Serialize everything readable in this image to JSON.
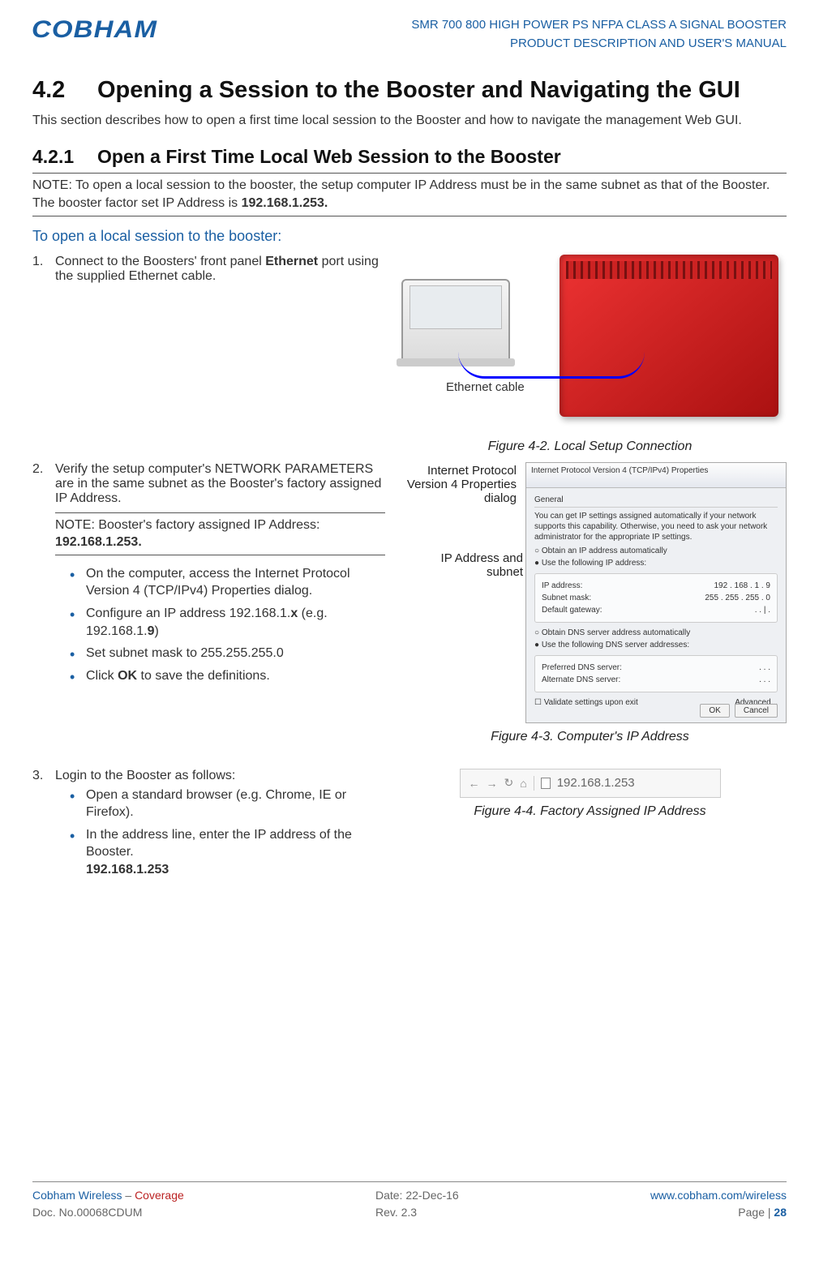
{
  "header": {
    "logo_text": "COBHAM",
    "title_line1": "SMR 700 800 HIGH POWER PS NFPA CLASS A SIGNAL BOOSTER",
    "title_line2": "PRODUCT DESCRIPTION AND USER'S MANUAL"
  },
  "section": {
    "number": "4.2",
    "title": "Opening a Session to the Booster and Navigating the GUI",
    "intro": "This section describes how to open a first time local session to the Booster and how to navigate the management Web GUI."
  },
  "subsection": {
    "number": "4.2.1",
    "title": "Open a First Time Local Web Session to the Booster"
  },
  "note": {
    "prefix": "NOTE: ",
    "text1": "To open a local session to the booster, the setup computer IP Address must be in the same subnet as that of the Booster. The booster factor set IP Address is ",
    "ip": "192.168.1.253."
  },
  "procedure_title": "To open a local session to the booster:",
  "step1": {
    "num": "1.",
    "text_a": "Connect to the Boosters' front panel ",
    "eth": "Ethernet",
    "text_b": " port using the supplied Ethernet cable.",
    "cable_label": "Ethernet cable",
    "caption": "Figure 4-2. Local Setup Connection"
  },
  "step2": {
    "num": "2.",
    "lead": "Verify the setup computer's NETWORK PARAMETERS are in the same subnet as the Booster's factory assigned IP Address.",
    "note_prefix": "NOTE:  ",
    "note_text": "Booster's factory assigned IP Address: ",
    "note_ip": "192.168.1.253.",
    "b1": "On the computer, access the Internet Protocol Version 4 (TCP/IPv4) Properties dialog.",
    "b2_a": "Configure an IP address 192.168.1.",
    "b2_x": "x",
    "b2_b": " (e.g. 192.168.1.",
    "b2_9": "9",
    "b2_c": ")",
    "b3": "Set subnet mask to 255.255.255.0",
    "b4_a": "Click ",
    "b4_ok": "OK",
    "b4_b": " to save the definitions.",
    "annot1": "Internet Protocol Version 4 Properties dialog",
    "annot2": "IP Address and subnet",
    "caption": "Figure 4-3. Computer's IP Address",
    "dialog": {
      "title": "Internet Protocol Version 4 (TCP/IPv4) Properties",
      "tab": "General",
      "desc": "You can get IP settings assigned automatically if your network supports this capability. Otherwise, you need to ask your network administrator for the appropriate IP settings.",
      "r1": "Obtain an IP address automatically",
      "r2": "Use the following IP address:",
      "ip_lbl": "IP address:",
      "ip_val": "192 . 168 .  1  .  9",
      "mask_lbl": "Subnet mask:",
      "mask_val": "255 . 255 . 255 .  0",
      "gw_lbl": "Default gateway:",
      "gw_val": ".       .   |   .",
      "r3": "Obtain DNS server address automatically",
      "r4": "Use the following DNS server addresses:",
      "dns1_lbl": "Preferred DNS server:",
      "dns1_val": ".       .       .",
      "dns2_lbl": "Alternate DNS server:",
      "dns2_val": ".       .       .",
      "validate": "Validate settings upon exit",
      "adv": "Advanced...",
      "ok": "OK",
      "cancel": "Cancel"
    }
  },
  "step3": {
    "num": "3.",
    "lead": "Login to the Booster as follows:",
    "b1": "Open a standard browser (e.g. Chrome, IE or Firefox).",
    "b2": "In the address line, enter the IP address of the Booster.",
    "ip": "192.168.1.253",
    "url_shown": "192.168.1.253",
    "caption": "Figure 4-4. Factory Assigned  IP Address"
  },
  "footer": {
    "company": "Cobham Wireless",
    "dash": " – ",
    "coverage": "Coverage",
    "doc": "Doc. No.00068CDUM",
    "date_lbl": "Date: ",
    "date": "22-Dec-16",
    "rev_lbl": "Rev. ",
    "rev": "2.3",
    "url": "www.cobham.com/wireless",
    "page_lbl": "Page | ",
    "page_num": "28"
  }
}
